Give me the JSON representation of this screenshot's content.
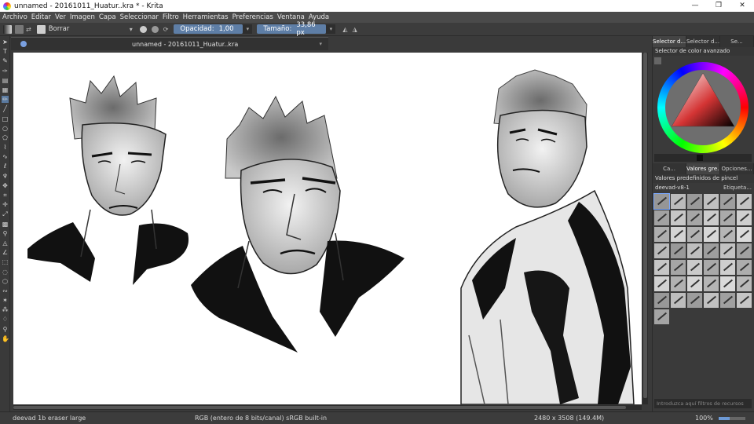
{
  "window": {
    "title": "unnamed - 20161011_Huatur..kra * - Krita",
    "controls": {
      "minimize": "—",
      "maximize": "❐",
      "close": "✕"
    }
  },
  "menu": [
    "Archivo",
    "Editar",
    "Ver",
    "Imagen",
    "Capa",
    "Seleccionar",
    "Filtro",
    "Herramientas",
    "Preferencias",
    "Ventana",
    "Ayuda"
  ],
  "tool_options": {
    "preset_name": "Borrar",
    "opacity_label": "Opacidad:",
    "opacity_value": "1,00",
    "size_label": "Tamaño:",
    "size_value": "33,86 px"
  },
  "document_tab": {
    "title": "unnamed - 20161011_Huatur..kra"
  },
  "dock": {
    "top_tabs": [
      "Selector d...",
      "Selector d...",
      "Se..."
    ],
    "color_panel_title": "Selector de color avanzado",
    "mid_tabs": [
      "Ca...",
      "Valores gre...",
      "Opciones..."
    ],
    "brush_panel_title": "Valores predefinidos de pincel",
    "brush_tag_selector": "deevad-v8-1",
    "brush_tag_label": "Etiqueta...",
    "brush_filter_placeholder": "Introduzca aquí filtros de recursos",
    "brush_count": 43
  },
  "status": {
    "brush": "deevad 1b eraser large",
    "color_model": "RGB (entero de 8 bits/canal)  sRGB built-in",
    "image_size": "2480 x 3508 (149.4M)",
    "zoom": "100%",
    "zoom_fraction": 0.4
  },
  "colors": {
    "accent": "#5e7ea6",
    "canvas": "#ffffff",
    "ui_dark": "#3a3a3a"
  }
}
